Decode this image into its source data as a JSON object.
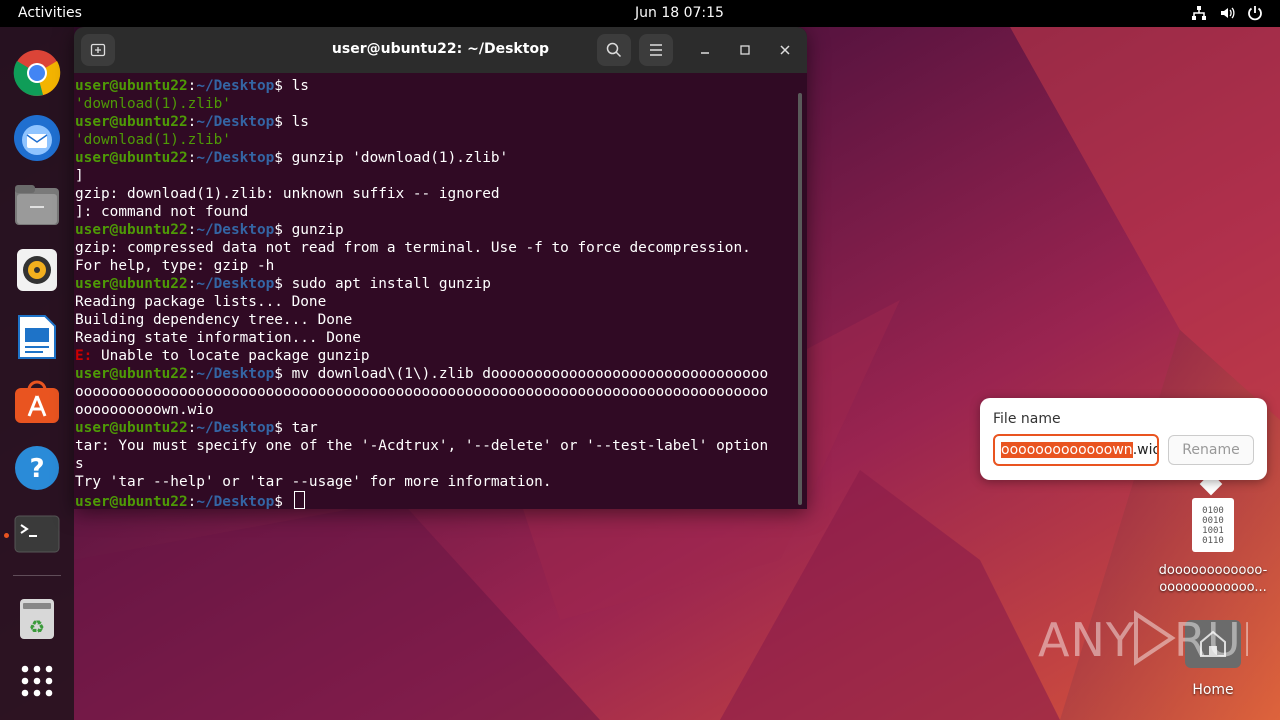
{
  "topbar": {
    "activities": "Activities",
    "clock": "Jun 18  07:15"
  },
  "dock": {
    "items": [
      "chrome-icon",
      "thunderbird-icon",
      "files-icon",
      "rhythmbox-icon",
      "writer-icon",
      "app-center-icon",
      "help-icon",
      "terminal-icon",
      "trash-icon",
      "show-apps-icon"
    ]
  },
  "terminal": {
    "title": "user@ubuntu22: ~/Desktop",
    "prompt_user": "user@ubuntu22",
    "prompt_path": "~/Desktop",
    "lines": [
      {
        "type": "prompt",
        "cmd": " ls"
      },
      {
        "type": "quoted",
        "text": "'download(1).zlib'"
      },
      {
        "type": "prompt",
        "cmd": " ls"
      },
      {
        "type": "quoted",
        "text": "'download(1).zlib'"
      },
      {
        "type": "prompt",
        "cmd": " gunzip 'download(1).zlib'"
      },
      {
        "type": "out",
        "text": "]"
      },
      {
        "type": "out",
        "text": "gzip: download(1).zlib: unknown suffix -- ignored"
      },
      {
        "type": "out",
        "text": "]: command not found"
      },
      {
        "type": "prompt",
        "cmd": " gunzip"
      },
      {
        "type": "out",
        "text": "gzip: compressed data not read from a terminal. Use -f to force decompression."
      },
      {
        "type": "out",
        "text": "For help, type: gzip -h"
      },
      {
        "type": "prompt",
        "cmd": " sudo apt install gunzip"
      },
      {
        "type": "out",
        "text": "Reading package lists... Done"
      },
      {
        "type": "out",
        "text": "Building dependency tree... Done"
      },
      {
        "type": "out",
        "text": "Reading state information... Done"
      },
      {
        "type": "err",
        "label": "E:",
        "text": " Unable to locate package gunzip"
      },
      {
        "type": "prompt",
        "cmd": " mv download\\(1\\).zlib doooooooooooooooooooooooooooooooo"
      },
      {
        "type": "out",
        "text": "oooooooooooooooooooooooooooooooooooooooooooooooooooooooooooooooooooooooooooooooo"
      },
      {
        "type": "out",
        "text": "oooooooooown.wio"
      },
      {
        "type": "prompt",
        "cmd": " tar"
      },
      {
        "type": "out",
        "text": "tar: You must specify one of the '-Acdtrux', '--delete' or '--test-label' option"
      },
      {
        "type": "out",
        "text": "s"
      },
      {
        "type": "out",
        "text": "Try 'tar --help' or 'tar --usage' for more information."
      },
      {
        "type": "cursor",
        "cmd": " "
      }
    ]
  },
  "rename_popover": {
    "label": "File name",
    "selected_text": "ooooooooooooown",
    "extension": ".wio",
    "rename_button": "Rename"
  },
  "desktop": {
    "file_line1": "doooooooooooo-",
    "file_line2": "oooooooooooo...",
    "file_bits": "0100\n0010\n1001\n0110",
    "home_label": "Home"
  },
  "watermark": "ANY RUN"
}
